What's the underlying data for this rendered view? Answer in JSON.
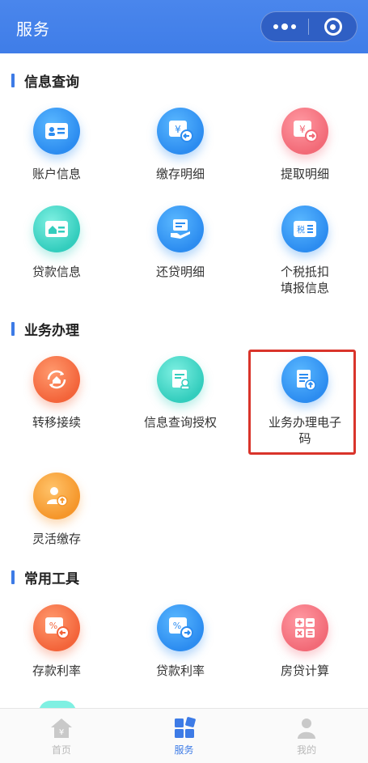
{
  "header": {
    "title": "服务"
  },
  "sections": [
    {
      "title": "信息查询",
      "items": [
        {
          "label": "账户信息",
          "icon": "id-card-icon",
          "color": "#2c8cf0"
        },
        {
          "label": "缴存明细",
          "icon": "yuan-card-icon",
          "color": "#2c8cf0"
        },
        {
          "label": "提取明细",
          "icon": "yuan-withdraw-icon",
          "color": "#f26a77"
        },
        {
          "label": "贷款信息",
          "icon": "house-card-icon",
          "color": "#33cdbd"
        },
        {
          "label": "还贷明细",
          "icon": "repay-hand-icon",
          "color": "#2c8cf0"
        },
        {
          "label": "个税抵扣\n填报信息",
          "label_line1": "个税抵扣",
          "label_line2": "填报信息",
          "icon": "tax-card-icon",
          "icon_text": "税",
          "color": "#2c8cf0"
        }
      ]
    },
    {
      "title": "业务办理",
      "items": [
        {
          "label": "转移接续",
          "icon": "transfer-house-icon",
          "color": "#f3643a"
        },
        {
          "label": "信息查询授权",
          "icon": "authorize-doc-icon",
          "color": "#33cdbd"
        },
        {
          "label_line1": "业务办理电子",
          "label_line2": "码",
          "icon": "e-code-doc-icon",
          "color": "#2c8cf0",
          "highlighted": true
        },
        {
          "label": "灵活缴存",
          "icon": "person-upload-icon",
          "color": "#f5962a"
        }
      ]
    },
    {
      "title": "常用工具",
      "items": [
        {
          "label": "存款利率",
          "icon": "percent-card-icon",
          "icon_text": "%",
          "color": "#f3643a"
        },
        {
          "label": "贷款利率",
          "icon": "percent-loan-icon",
          "icon_text": "%",
          "color": "#2c8cf0"
        },
        {
          "label": "房贷计算",
          "icon": "calculator-icon",
          "color": "#f26a77"
        }
      ]
    }
  ],
  "tabbar": [
    {
      "label": "首页",
      "icon": "home-yuan-icon",
      "active": false
    },
    {
      "label": "服务",
      "icon": "grid-apps-icon",
      "active": true,
      "color": "#3d7be6"
    },
    {
      "label": "我的",
      "icon": "user-icon",
      "active": false
    }
  ]
}
